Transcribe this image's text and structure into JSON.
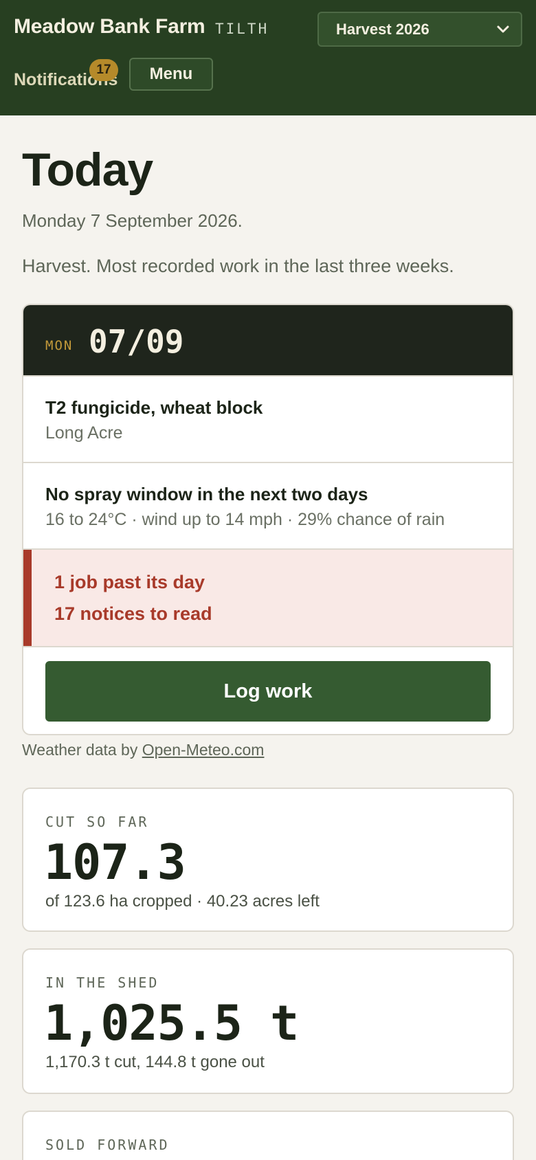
{
  "header": {
    "farm_name": "Meadow Bank Farm",
    "app_tag": "TILTH",
    "season": "Harvest 2026",
    "notifications_label": "Notifications",
    "notifications_count": "17",
    "menu_label": "Menu"
  },
  "page": {
    "title": "Today",
    "date": "Monday 7 September 2026.",
    "subtitle": "Harvest. Most recorded work in the last three weeks."
  },
  "day_card": {
    "dow": "MON",
    "date": "07/09",
    "task_title": "T2 fungicide, wheat block",
    "task_field": "Long Acre",
    "weather_title": "No spray window in the next two days",
    "weather_detail": "16 to 24°C · wind up to 14 mph · 29% chance of rain",
    "alerts": [
      "1 job past its day",
      "17 notices to read"
    ],
    "action_label": "Log work"
  },
  "credit": {
    "prefix": "Weather data by",
    "link": "Open-Meteo.com"
  },
  "stats": [
    {
      "label": "CUT SO FAR",
      "value": "107.3",
      "note": "of 123.6 ha cropped · 40.23 acres left"
    },
    {
      "label": "IN THE SHED",
      "value": "1,025.5 t",
      "note": "1,170.3 t cut, 144.8 t gone out"
    },
    {
      "label": "SOLD FORWARD"
    }
  ],
  "colors": {
    "header_bg": "#273f21",
    "accent_green": "#355b31",
    "alert_red": "#a83a2a",
    "badge_gold": "#b58a2a"
  },
  "icons": {
    "season_select": "chevron-down-icon"
  }
}
